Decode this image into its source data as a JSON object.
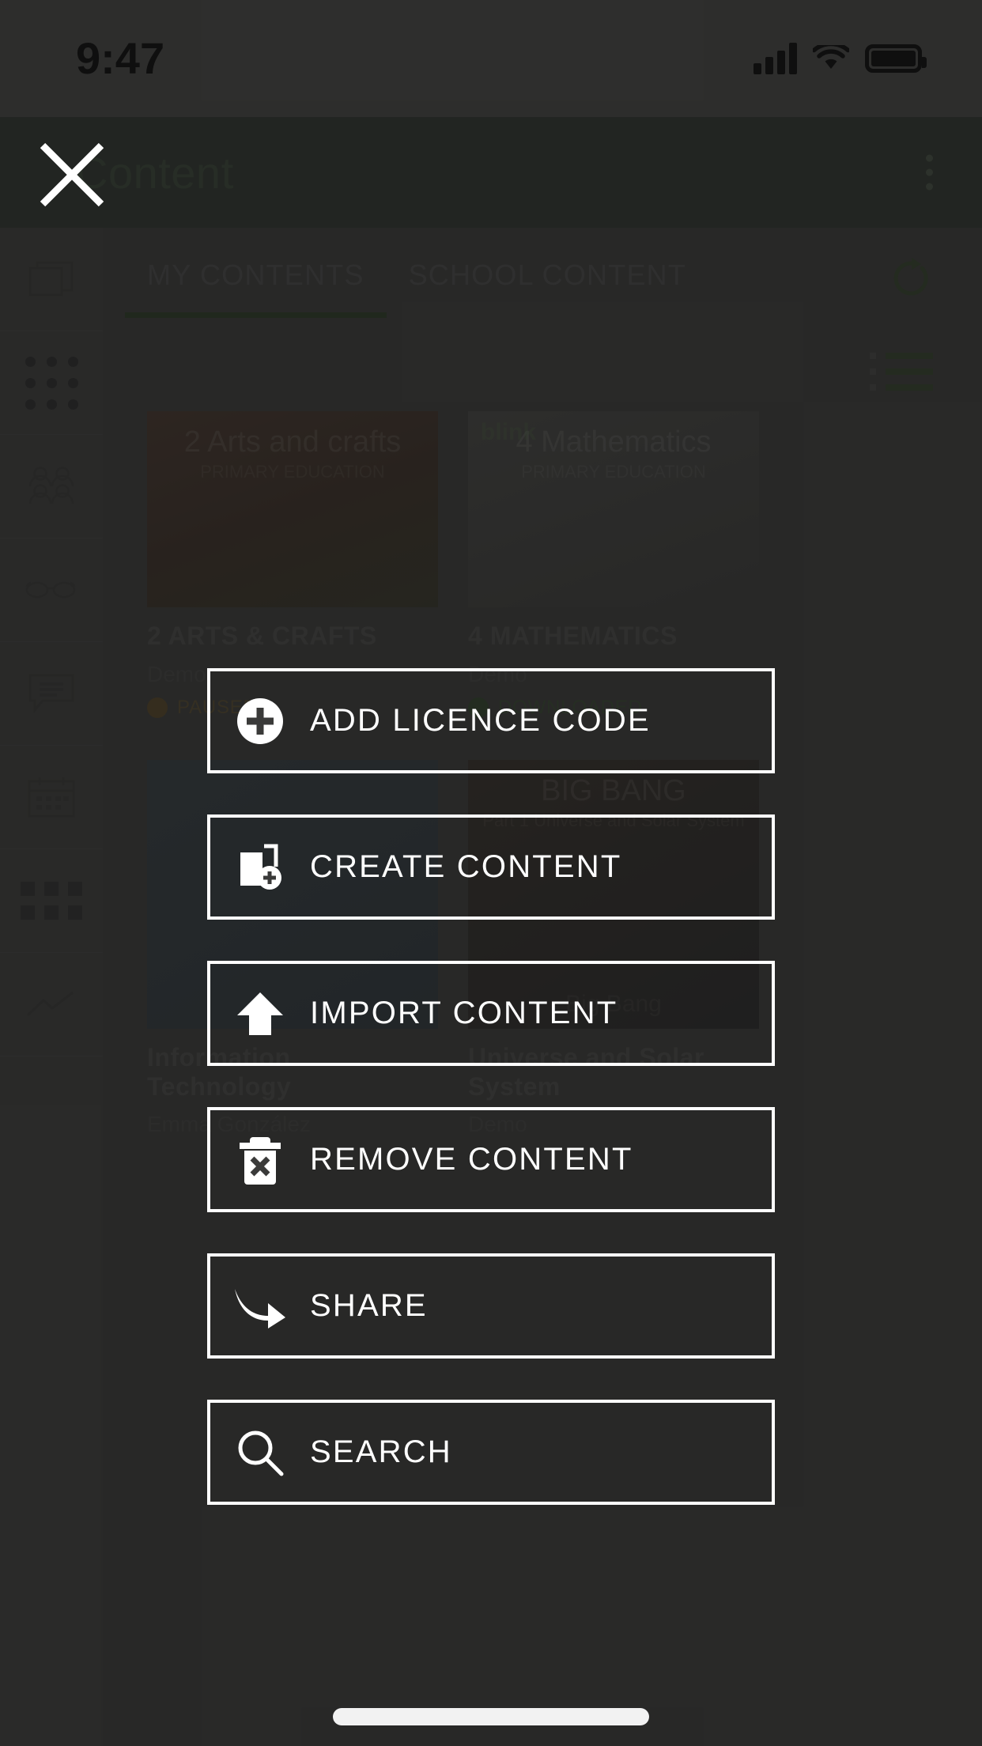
{
  "status_bar": {
    "time": "9:47",
    "icons": [
      "cellular-signal-icon",
      "wifi-icon",
      "battery-icon"
    ]
  },
  "header": {
    "title": "Content",
    "close_icon": "close-icon",
    "overflow_icon": "kebab-menu-icon"
  },
  "sidebar": {
    "items": [
      {
        "icon": "content-layers-icon",
        "name": "content"
      },
      {
        "icon": "dots-grid-icon",
        "name": "groups"
      },
      {
        "icon": "people-icon",
        "name": "students"
      },
      {
        "icon": "glasses-icon",
        "name": "supervision"
      },
      {
        "icon": "chat-bubble-icon",
        "name": "messages"
      },
      {
        "icon": "calendar-icon",
        "name": "calendar"
      },
      {
        "icon": "apps-grid-icon",
        "name": "apps"
      },
      {
        "icon": "analytics-line-icon",
        "name": "analytics"
      }
    ]
  },
  "content_pane": {
    "tabs": [
      {
        "label": "MY CONTENTS",
        "active": true
      },
      {
        "label": "SCHOOL CONTENT",
        "active": false
      }
    ],
    "refresh_icon": "refresh-icon",
    "list_view_icon": "list-view-icon",
    "cards": [
      {
        "thumb_title": "2 Arts and crafts",
        "thumb_sub": "PRIMARY EDUCATION",
        "title": "2 ARTS & CRAFTS",
        "subtitle": "Demo",
        "status": "PAUSED",
        "status_kind": "paused",
        "badge": ""
      },
      {
        "thumb_title": "4 Mathematics",
        "thumb_sub": "PRIMARY EDUCATION",
        "title": "4 MATHEMATICS",
        "subtitle": "Demo",
        "status": "DOWNLOADED",
        "status_kind": "downloaded",
        "badge": "blink"
      },
      {
        "thumb_title": "",
        "thumb_sub": "",
        "title": "Information Technology",
        "subtitle": "Emma González",
        "status": "",
        "status_kind": "",
        "badge": ""
      },
      {
        "thumb_title": "BIG BANG",
        "thumb_sub": "Part 1 Universe and Solar System",
        "title": "Universe and Solar System",
        "subtitle": "Demo",
        "status": "",
        "status_kind": "",
        "badge": "Big Bang"
      }
    ]
  },
  "action_menu": {
    "items": [
      {
        "label": "ADD LICENCE CODE",
        "icon": "plus-circle-icon"
      },
      {
        "label": "CREATE CONTENT",
        "icon": "create-content-icon"
      },
      {
        "label": "IMPORT CONTENT",
        "icon": "upload-arrow-icon"
      },
      {
        "label": "REMOVE CONTENT",
        "icon": "trash-x-icon"
      },
      {
        "label": "SHARE",
        "icon": "share-arrow-icon"
      },
      {
        "label": "SEARCH",
        "icon": "search-icon"
      }
    ]
  },
  "colors": {
    "accent_green": "#2e4028",
    "header_green": "#343a32",
    "overlay": "rgba(20,20,20,0.52)",
    "white": "#ffffff",
    "status_bar_bg": "#4a4a48"
  },
  "home_indicator": "home-indicator"
}
